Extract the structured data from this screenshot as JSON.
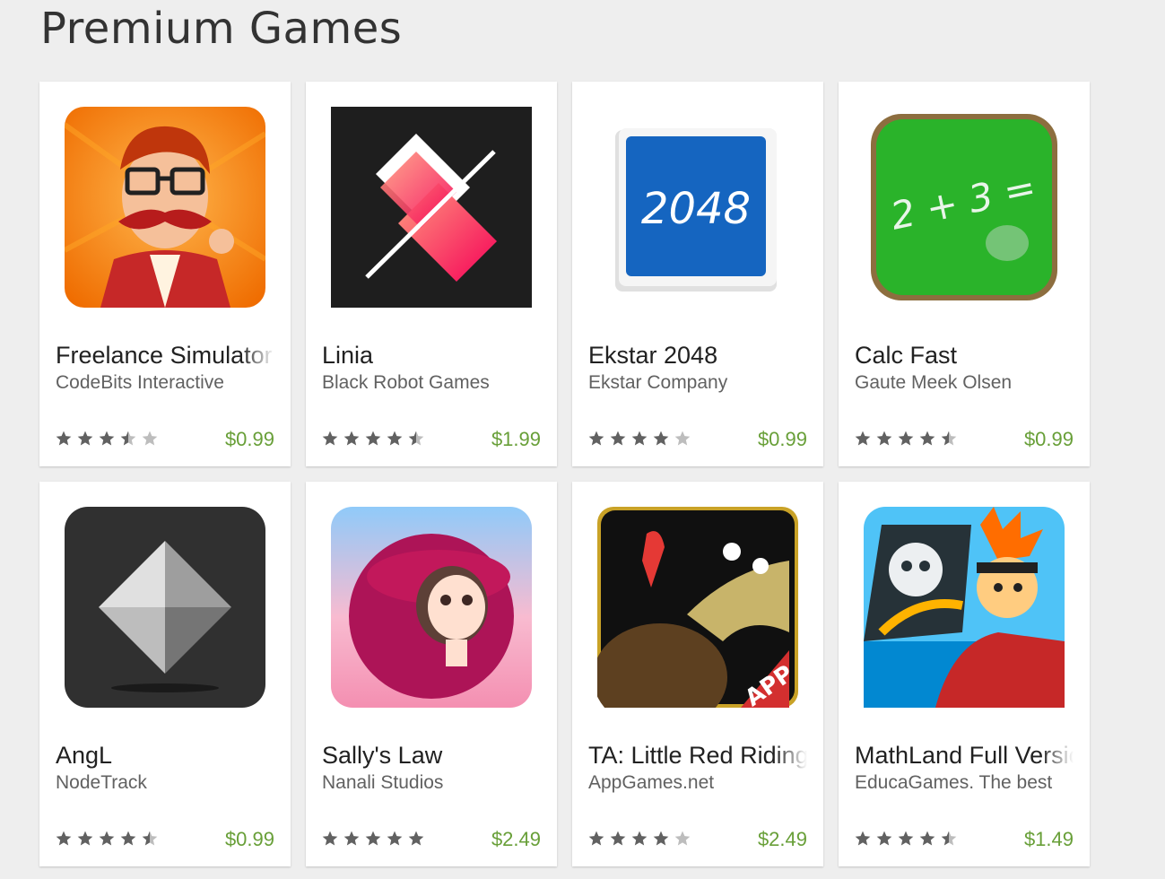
{
  "section": {
    "title": "Premium Games"
  },
  "colors": {
    "price": "#689f38",
    "star_filled": "#616161",
    "star_empty": "#bdbdbd"
  },
  "games": [
    {
      "title": "Freelance Simulator",
      "developer": "CodeBits Interactive",
      "price": "$0.99",
      "rating": 3.5,
      "icon": "freelance-simulator-icon"
    },
    {
      "title": "Linia",
      "developer": "Black Robot Games",
      "price": "$1.99",
      "rating": 4.5,
      "icon": "linia-icon"
    },
    {
      "title": "Ekstar 2048",
      "developer": "Ekstar Company",
      "price": "$0.99",
      "rating": 4,
      "icon": "ekstar-2048-icon",
      "icon_text": "2048"
    },
    {
      "title": "Calc Fast",
      "developer": "Gaute Meek Olsen",
      "price": "$0.99",
      "rating": 4.5,
      "icon": "calc-fast-icon",
      "icon_text": "2 + 3 ="
    },
    {
      "title": "AngL",
      "developer": "NodeTrack",
      "price": "$0.99",
      "rating": 4.5,
      "icon": "angl-icon"
    },
    {
      "title": "Sally's Law",
      "developer": "Nanali Studios",
      "price": "$2.49",
      "rating": 5,
      "icon": "sallys-law-icon"
    },
    {
      "title": "TA: Little Red Riding Hood",
      "developer": "AppGames.net",
      "price": "$2.49",
      "rating": 4,
      "icon": "little-red-riding-hood-icon",
      "icon_text": "APP"
    },
    {
      "title": "MathLand Full Version",
      "developer": "EducaGames. The best",
      "price": "$1.49",
      "rating": 4.5,
      "icon": "mathland-icon"
    }
  ]
}
